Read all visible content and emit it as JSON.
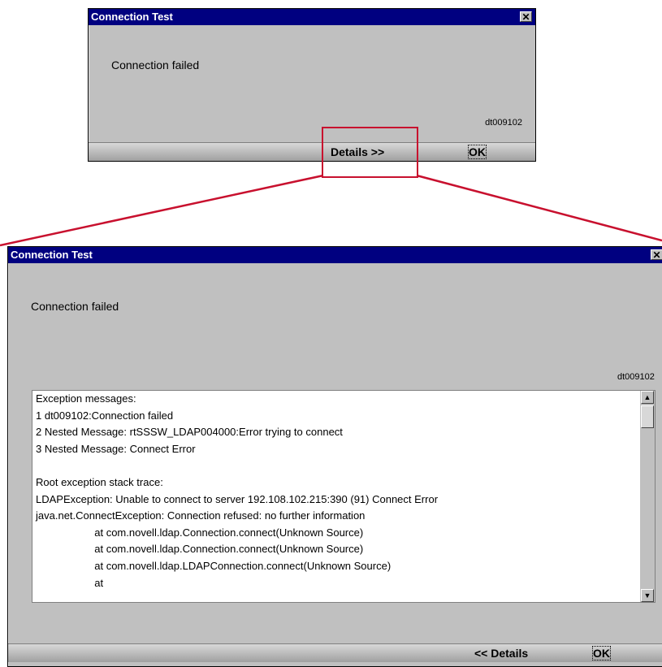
{
  "small_dialog": {
    "title": "Connection Test",
    "close_label": "✕",
    "message": "Connection failed",
    "code": "dt009102",
    "details_label": "Details >>",
    "ok_label": "OK"
  },
  "large_dialog": {
    "title": "Connection Test",
    "close_label": "✕",
    "message": "Connection failed",
    "code": "dt009102",
    "details_lines": [
      "Exception messages:",
      "1 dt009102:Connection failed",
      "2 Nested Message: rtSSSW_LDAP004000:Error trying to connect",
      "3 Nested Message: Connect Error",
      "",
      "Root exception stack trace:",
      "LDAPException: Unable to connect to server 192.108.102.215:390 (91) Connect Error",
      "java.net.ConnectException: Connection refused: no further information",
      "                    at com.novell.ldap.Connection.connect(Unknown Source)",
      "                    at com.novell.ldap.Connection.connect(Unknown Source)",
      "                    at com.novell.ldap.LDAPConnection.connect(Unknown Source)",
      "                    at"
    ],
    "details_label": "<< Details",
    "ok_label": "OK"
  },
  "colors": {
    "titlebar": "#000080",
    "highlight": "#c8102e",
    "dialog_bg": "#c0c0c0"
  }
}
